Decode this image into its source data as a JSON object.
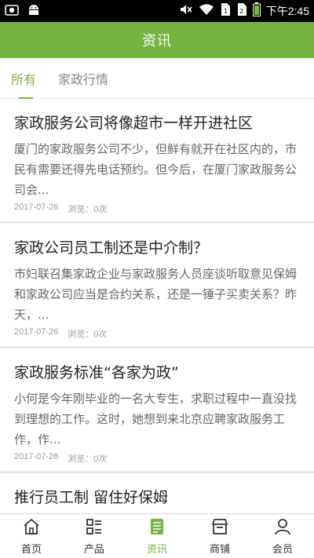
{
  "status_bar": {
    "time": "下午2:45",
    "left_icons": [
      "screenshot-icon",
      "android-icon"
    ],
    "right_icons": [
      "mute-icon",
      "wifi-icon",
      "sim1-icon",
      "sim2-icon",
      "battery-icon"
    ]
  },
  "header": {
    "title": "资讯"
  },
  "tabs": [
    {
      "label": "所有",
      "active": true
    },
    {
      "label": "家政行情",
      "active": false
    }
  ],
  "news": [
    {
      "title": "家政服务公司将像超市一样开进社区",
      "summary": "厦门的家政服务公司不少，但鲜有就开在社区内的，市民有需要还得先电话预约。但今后，在厦门家政服务公司会...",
      "date": "2017-07-26",
      "views": "浏览：0次"
    },
    {
      "title": "家政公司员工制还是中介制？",
      "summary": "市妇联召集家政企业与家政服务人员座谈听取意见保姆和家政公司应当是合约关系，还是一锤子买卖关系？昨天，...",
      "date": "2017-07-26",
      "views": "浏览：0次"
    },
    {
      "title": "家政服务标准“各家为政”",
      "summary": "小何是今年刚毕业的一名大专生，求职过程中一直没找到理想的工作。这时，她想到来北京应聘家政服务工作，作...",
      "date": "2017-07-26",
      "views": "浏览：0次"
    },
    {
      "title": "推行员工制 留住好保姆",
      "summary": "",
      "date": "",
      "views": ""
    }
  ],
  "bottom_nav": [
    {
      "label": "首页",
      "icon": "home-icon",
      "active": false
    },
    {
      "label": "产品",
      "icon": "product-list-icon",
      "active": false
    },
    {
      "label": "资讯",
      "icon": "news-icon",
      "active": true
    },
    {
      "label": "商铺",
      "icon": "store-icon",
      "active": false
    },
    {
      "label": "会员",
      "icon": "user-icon",
      "active": false
    }
  ],
  "colors": {
    "accent": "#76b340",
    "text": "#222222",
    "muted": "#999999"
  }
}
